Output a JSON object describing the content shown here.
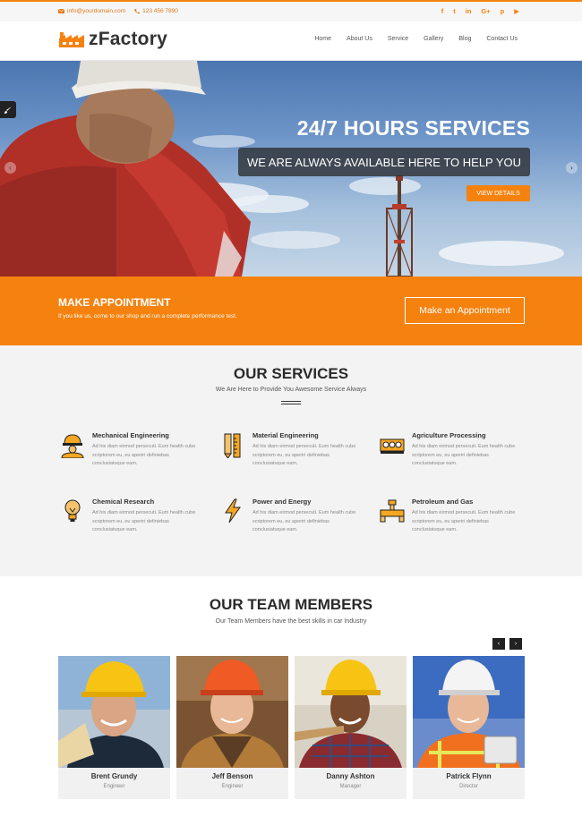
{
  "topbar": {
    "email": "info@yourdomain.com",
    "phone": "123 456 7890",
    "social_icons": [
      "facebook-icon",
      "twitter-icon",
      "linkedin-icon",
      "google-plus-icon",
      "pinterest-icon",
      "youtube-icon"
    ],
    "social_glyphs": [
      "f",
      "t",
      "in",
      "G+",
      "p",
      "▶"
    ]
  },
  "header": {
    "logo_text": "zFactory",
    "nav": [
      "Home",
      "About Us",
      "Service",
      "Gallery",
      "Blog",
      "Contact Us"
    ]
  },
  "hero": {
    "title": "24/7 HOURS SERVICES",
    "subtitle": "WE ARE ALWAYS AVAILABLE HERE TO HELP YOU",
    "button": "VIEW DETAILS",
    "prev": "‹",
    "next": "›"
  },
  "appointment": {
    "heading": "MAKE APPOINTMENT",
    "text": "If you like us, come to our shop and run a complete performance test.",
    "button": "Make an Appointment"
  },
  "services": {
    "title": "OUR SERVICES",
    "subtitle": "We Are Here to Provide You Awesome Service Always",
    "items": [
      {
        "name": "Mechanical Engineering",
        "desc": "Ad his diam eirmod persecuti. Eum health cube scriptorem eu, eu aperiri definiebas conclusiatuque eam.",
        "icon": "engineer-icon"
      },
      {
        "name": "Material Engineering",
        "desc": "Ad his diam eirmod persecuti. Eum health cube scriptorem eu, eu aperiri definiebas conclusiatuque eam.",
        "icon": "pencil-ruler-icon"
      },
      {
        "name": "Agriculture Processing",
        "desc": "Ad his diam eirmod persecuti. Eum health cube scriptorem eu, eu aperiri definiebas conclusiatuque eam.",
        "icon": "tractor-icon"
      },
      {
        "name": "Chemical Research",
        "desc": "Ad his diam eirmod persecuti. Eum health cube scriptorem eu, eu aperiri definiebas conclusiatuque eam.",
        "icon": "lightbulb-icon"
      },
      {
        "name": "Power and Energy",
        "desc": "Ad his diam eirmod persecuti. Eum health cube scriptorem eu, eu aperiri definiebas conclusiatuque eam.",
        "icon": "lightning-icon"
      },
      {
        "name": "Petroleum and Gas",
        "desc": "Ad his diam eirmod persecuti. Eum health cube scriptorem eu, eu aperiri definiebas conclusiatuque eam.",
        "icon": "pipeline-icon"
      }
    ]
  },
  "team": {
    "title": "OUR TEAM MEMBERS",
    "subtitle": "Our Team Members have the best skills in car Industry",
    "prev": "‹",
    "next": "›",
    "members": [
      {
        "name": "Brent Grundy",
        "role": "Engineer"
      },
      {
        "name": "Jeff Benson",
        "role": "Engineer"
      },
      {
        "name": "Danny Ashton",
        "role": "Manager"
      },
      {
        "name": "Patrick Flynn",
        "role": "Director"
      }
    ]
  },
  "colors": {
    "accent": "#f5820f",
    "dark": "#2a2a2a",
    "light_bg": "#f3f3f3"
  }
}
